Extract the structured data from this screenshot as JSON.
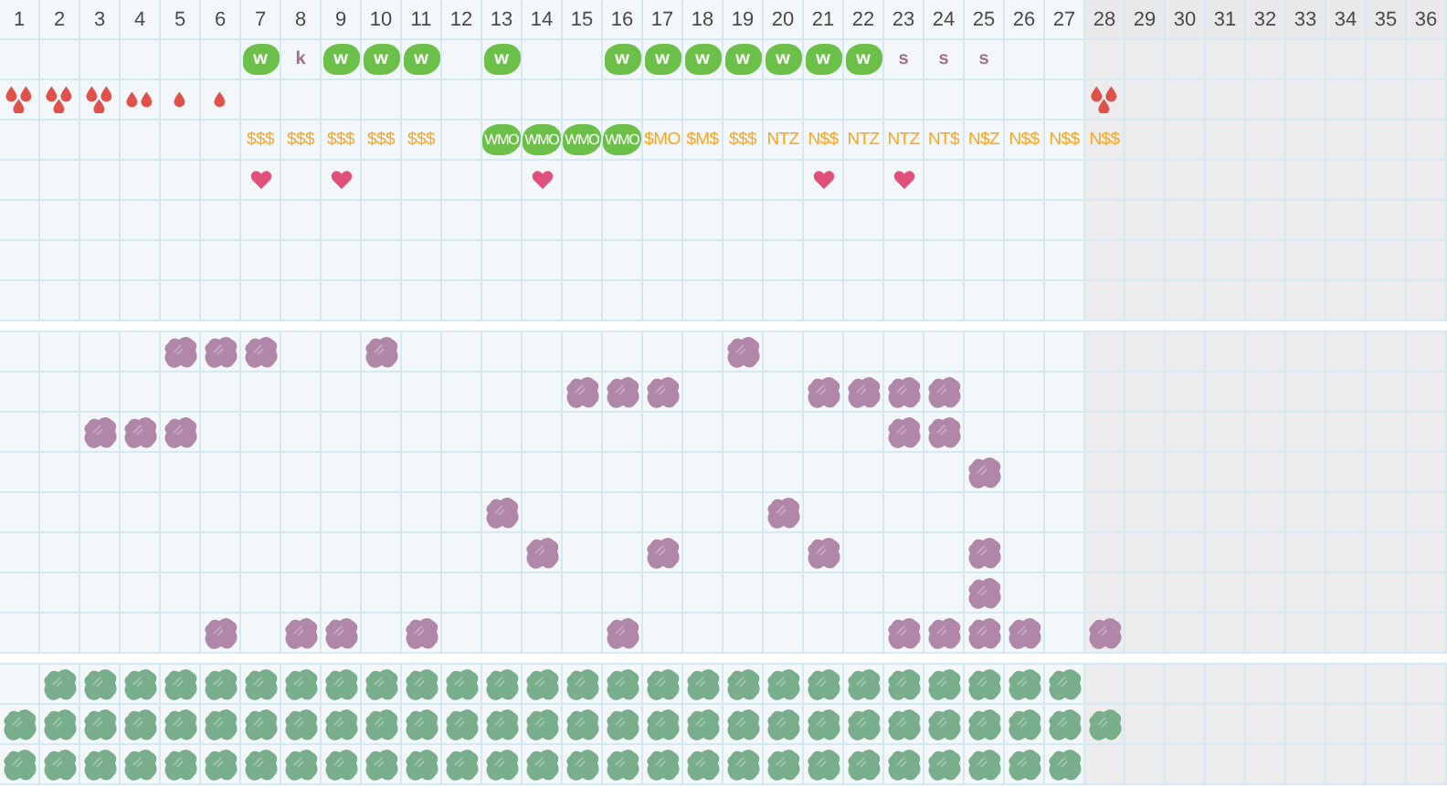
{
  "columns": [
    {
      "label": "1",
      "shaded": false
    },
    {
      "label": "2",
      "shaded": false
    },
    {
      "label": "3",
      "shaded": false
    },
    {
      "label": "4",
      "shaded": false
    },
    {
      "label": "5",
      "shaded": false
    },
    {
      "label": "6",
      "shaded": false
    },
    {
      "label": "7",
      "shaded": false
    },
    {
      "label": "8",
      "shaded": false
    },
    {
      "label": "9",
      "shaded": false
    },
    {
      "label": "10",
      "shaded": false
    },
    {
      "label": "11",
      "shaded": false
    },
    {
      "label": "12",
      "shaded": false
    },
    {
      "label": "13",
      "shaded": false
    },
    {
      "label": "14",
      "shaded": false
    },
    {
      "label": "15",
      "shaded": false
    },
    {
      "label": "16",
      "shaded": false
    },
    {
      "label": "17",
      "shaded": false
    },
    {
      "label": "18",
      "shaded": false
    },
    {
      "label": "19",
      "shaded": false
    },
    {
      "label": "20",
      "shaded": false
    },
    {
      "label": "21",
      "shaded": false
    },
    {
      "label": "22",
      "shaded": false
    },
    {
      "label": "23",
      "shaded": false
    },
    {
      "label": "24",
      "shaded": false
    },
    {
      "label": "25",
      "shaded": false
    },
    {
      "label": "26",
      "shaded": false
    },
    {
      "label": "27",
      "shaded": false
    },
    {
      "label": "28",
      "shaded": true
    },
    {
      "label": "29",
      "shaded": true
    },
    {
      "label": "30",
      "shaded": true
    },
    {
      "label": "31",
      "shaded": true
    },
    {
      "label": "32",
      "shaded": true
    },
    {
      "label": "33",
      "shaded": true
    },
    {
      "label": "34",
      "shaded": true
    },
    {
      "label": "35",
      "shaded": true
    },
    {
      "label": "36",
      "shaded": true
    }
  ],
  "sections": [
    {
      "kind": "events",
      "rows": [
        [
          null,
          null,
          null,
          null,
          null,
          null,
          {
            "kind": "tag",
            "text": "w"
          },
          {
            "kind": "letter",
            "text": "k"
          },
          {
            "kind": "tag",
            "text": "w"
          },
          {
            "kind": "tag",
            "text": "w"
          },
          {
            "kind": "tag",
            "text": "w"
          },
          null,
          {
            "kind": "tag",
            "text": "w"
          },
          null,
          null,
          {
            "kind": "tag",
            "text": "w"
          },
          {
            "kind": "tag",
            "text": "w"
          },
          {
            "kind": "tag",
            "text": "w"
          },
          {
            "kind": "tag",
            "text": "w"
          },
          {
            "kind": "tag",
            "text": "w"
          },
          {
            "kind": "tag",
            "text": "w"
          },
          {
            "kind": "tag",
            "text": "w"
          },
          {
            "kind": "letter",
            "text": "s"
          },
          {
            "kind": "letter",
            "text": "s"
          },
          {
            "kind": "letter",
            "text": "s"
          }
        ],
        [
          {
            "kind": "drop-trio"
          },
          {
            "kind": "drop-trio"
          },
          {
            "kind": "drop-trio"
          },
          {
            "kind": "drop-pair"
          },
          {
            "kind": "drop"
          },
          {
            "kind": "drop"
          },
          null,
          null,
          null,
          null,
          null,
          null,
          null,
          null,
          null,
          null,
          null,
          null,
          null,
          null,
          null,
          null,
          null,
          null,
          null,
          null,
          null,
          {
            "kind": "drop-trio"
          }
        ],
        [
          null,
          null,
          null,
          null,
          null,
          null,
          {
            "kind": "money",
            "text": "$$$"
          },
          {
            "kind": "money",
            "text": "$$$"
          },
          {
            "kind": "money",
            "text": "$$$"
          },
          {
            "kind": "money",
            "text": "$$$"
          },
          {
            "kind": "money",
            "text": "$$$"
          },
          null,
          {
            "kind": "tag",
            "text": "WMO"
          },
          {
            "kind": "tag",
            "text": "WMO"
          },
          {
            "kind": "tag",
            "text": "WMO"
          },
          {
            "kind": "tag",
            "text": "WMO"
          },
          {
            "kind": "money",
            "text": "$MO"
          },
          {
            "kind": "money",
            "text": "$M$"
          },
          {
            "kind": "money",
            "text": "$$$"
          },
          {
            "kind": "money",
            "text": "NTZ"
          },
          {
            "kind": "money",
            "text": "N$$"
          },
          {
            "kind": "money",
            "text": "NTZ"
          },
          {
            "kind": "money",
            "text": "NTZ"
          },
          {
            "kind": "money",
            "text": "NT$"
          },
          {
            "kind": "money",
            "text": "N$Z"
          },
          {
            "kind": "money",
            "text": "N$$"
          },
          {
            "kind": "money",
            "text": "N$$"
          },
          {
            "kind": "money",
            "text": "N$$"
          }
        ],
        [
          null,
          null,
          null,
          null,
          null,
          null,
          {
            "kind": "heart"
          },
          null,
          {
            "kind": "heart"
          },
          null,
          null,
          null,
          null,
          {
            "kind": "heart"
          },
          null,
          null,
          null,
          null,
          null,
          null,
          {
            "kind": "heart"
          },
          null,
          {
            "kind": "heart"
          }
        ]
      ]
    },
    {
      "kind": "spots",
      "color": "#b087a8",
      "rows": [
        [
          null,
          null,
          null,
          null,
          {
            "kind": "blob"
          },
          {
            "kind": "blob"
          },
          {
            "kind": "blob"
          },
          null,
          null,
          {
            "kind": "blob"
          },
          null,
          null,
          null,
          null,
          null,
          null,
          null,
          null,
          {
            "kind": "blob"
          }
        ],
        [
          null,
          null,
          null,
          null,
          null,
          null,
          null,
          null,
          null,
          null,
          null,
          null,
          null,
          null,
          {
            "kind": "blob"
          },
          {
            "kind": "blob"
          },
          {
            "kind": "blob"
          },
          null,
          null,
          null,
          {
            "kind": "blob"
          },
          {
            "kind": "blob"
          },
          {
            "kind": "blob"
          },
          {
            "kind": "blob"
          }
        ],
        [
          null,
          null,
          {
            "kind": "blob"
          },
          {
            "kind": "blob"
          },
          {
            "kind": "blob"
          },
          null,
          null,
          null,
          null,
          null,
          null,
          null,
          null,
          null,
          null,
          null,
          null,
          null,
          null,
          null,
          null,
          null,
          {
            "kind": "blob"
          },
          {
            "kind": "blob"
          }
        ],
        [
          null,
          null,
          null,
          null,
          null,
          null,
          null,
          null,
          null,
          null,
          null,
          null,
          null,
          null,
          null,
          null,
          null,
          null,
          null,
          null,
          null,
          null,
          null,
          null,
          {
            "kind": "blob"
          }
        ],
        [
          null,
          null,
          null,
          null,
          null,
          null,
          null,
          null,
          null,
          null,
          null,
          null,
          {
            "kind": "blob"
          },
          null,
          null,
          null,
          null,
          null,
          null,
          {
            "kind": "blob"
          }
        ],
        [
          null,
          null,
          null,
          null,
          null,
          null,
          null,
          null,
          null,
          null,
          null,
          null,
          null,
          {
            "kind": "blob"
          },
          null,
          null,
          {
            "kind": "blob"
          },
          null,
          null,
          null,
          {
            "kind": "blob"
          },
          null,
          null,
          null,
          {
            "kind": "blob"
          }
        ],
        [
          null,
          null,
          null,
          null,
          null,
          null,
          null,
          null,
          null,
          null,
          null,
          null,
          null,
          null,
          null,
          null,
          null,
          null,
          null,
          null,
          null,
          null,
          null,
          null,
          {
            "kind": "blob"
          }
        ],
        [
          null,
          null,
          null,
          null,
          null,
          {
            "kind": "blob"
          },
          null,
          {
            "kind": "blob"
          },
          {
            "kind": "blob"
          },
          null,
          {
            "kind": "blob"
          },
          null,
          null,
          null,
          null,
          {
            "kind": "blob"
          },
          null,
          null,
          null,
          null,
          null,
          null,
          {
            "kind": "blob"
          },
          {
            "kind": "blob"
          },
          {
            "kind": "blob"
          },
          {
            "kind": "blob"
          },
          null,
          {
            "kind": "blob"
          }
        ]
      ]
    },
    {
      "kind": "fill",
      "color": "#79ae8c",
      "rows": [
        [
          null,
          {
            "kind": "blob"
          },
          {
            "kind": "blob"
          },
          {
            "kind": "blob"
          },
          {
            "kind": "blob"
          },
          {
            "kind": "blob"
          },
          {
            "kind": "blob"
          },
          {
            "kind": "blob"
          },
          {
            "kind": "blob"
          },
          {
            "kind": "blob"
          },
          {
            "kind": "blob"
          },
          {
            "kind": "blob"
          },
          {
            "kind": "blob"
          },
          {
            "kind": "blob"
          },
          {
            "kind": "blob"
          },
          {
            "kind": "blob"
          },
          {
            "kind": "blob"
          },
          {
            "kind": "blob"
          },
          {
            "kind": "blob"
          },
          {
            "kind": "blob"
          },
          {
            "kind": "blob"
          },
          {
            "kind": "blob"
          },
          {
            "kind": "blob"
          },
          {
            "kind": "blob"
          },
          {
            "kind": "blob"
          },
          {
            "kind": "blob"
          },
          {
            "kind": "blob"
          }
        ],
        [
          {
            "kind": "blob"
          },
          {
            "kind": "blob"
          },
          {
            "kind": "blob"
          },
          {
            "kind": "blob"
          },
          {
            "kind": "blob"
          },
          {
            "kind": "blob"
          },
          {
            "kind": "blob"
          },
          {
            "kind": "blob"
          },
          {
            "kind": "blob"
          },
          {
            "kind": "blob"
          },
          {
            "kind": "blob"
          },
          {
            "kind": "blob"
          },
          {
            "kind": "blob"
          },
          {
            "kind": "blob"
          },
          {
            "kind": "blob"
          },
          {
            "kind": "blob"
          },
          {
            "kind": "blob"
          },
          {
            "kind": "blob"
          },
          {
            "kind": "blob"
          },
          {
            "kind": "blob"
          },
          {
            "kind": "blob"
          },
          {
            "kind": "blob"
          },
          {
            "kind": "blob"
          },
          {
            "kind": "blob"
          },
          {
            "kind": "blob"
          },
          {
            "kind": "blob"
          },
          {
            "kind": "blob"
          },
          {
            "kind": "blob"
          }
        ],
        [
          {
            "kind": "blob"
          },
          {
            "kind": "blob"
          },
          {
            "kind": "blob"
          },
          {
            "kind": "blob"
          },
          {
            "kind": "blob"
          },
          {
            "kind": "blob"
          },
          {
            "kind": "blob"
          },
          {
            "kind": "blob"
          },
          {
            "kind": "blob"
          },
          {
            "kind": "blob"
          },
          {
            "kind": "blob"
          },
          {
            "kind": "blob"
          },
          {
            "kind": "blob"
          },
          {
            "kind": "blob"
          },
          {
            "kind": "blob"
          },
          {
            "kind": "blob"
          },
          {
            "kind": "blob"
          },
          {
            "kind": "blob"
          },
          {
            "kind": "blob"
          },
          {
            "kind": "blob"
          },
          {
            "kind": "blob"
          },
          {
            "kind": "blob"
          },
          {
            "kind": "blob"
          },
          {
            "kind": "blob"
          },
          {
            "kind": "blob"
          },
          {
            "kind": "blob"
          },
          {
            "kind": "blob"
          }
        ]
      ]
    }
  ]
}
